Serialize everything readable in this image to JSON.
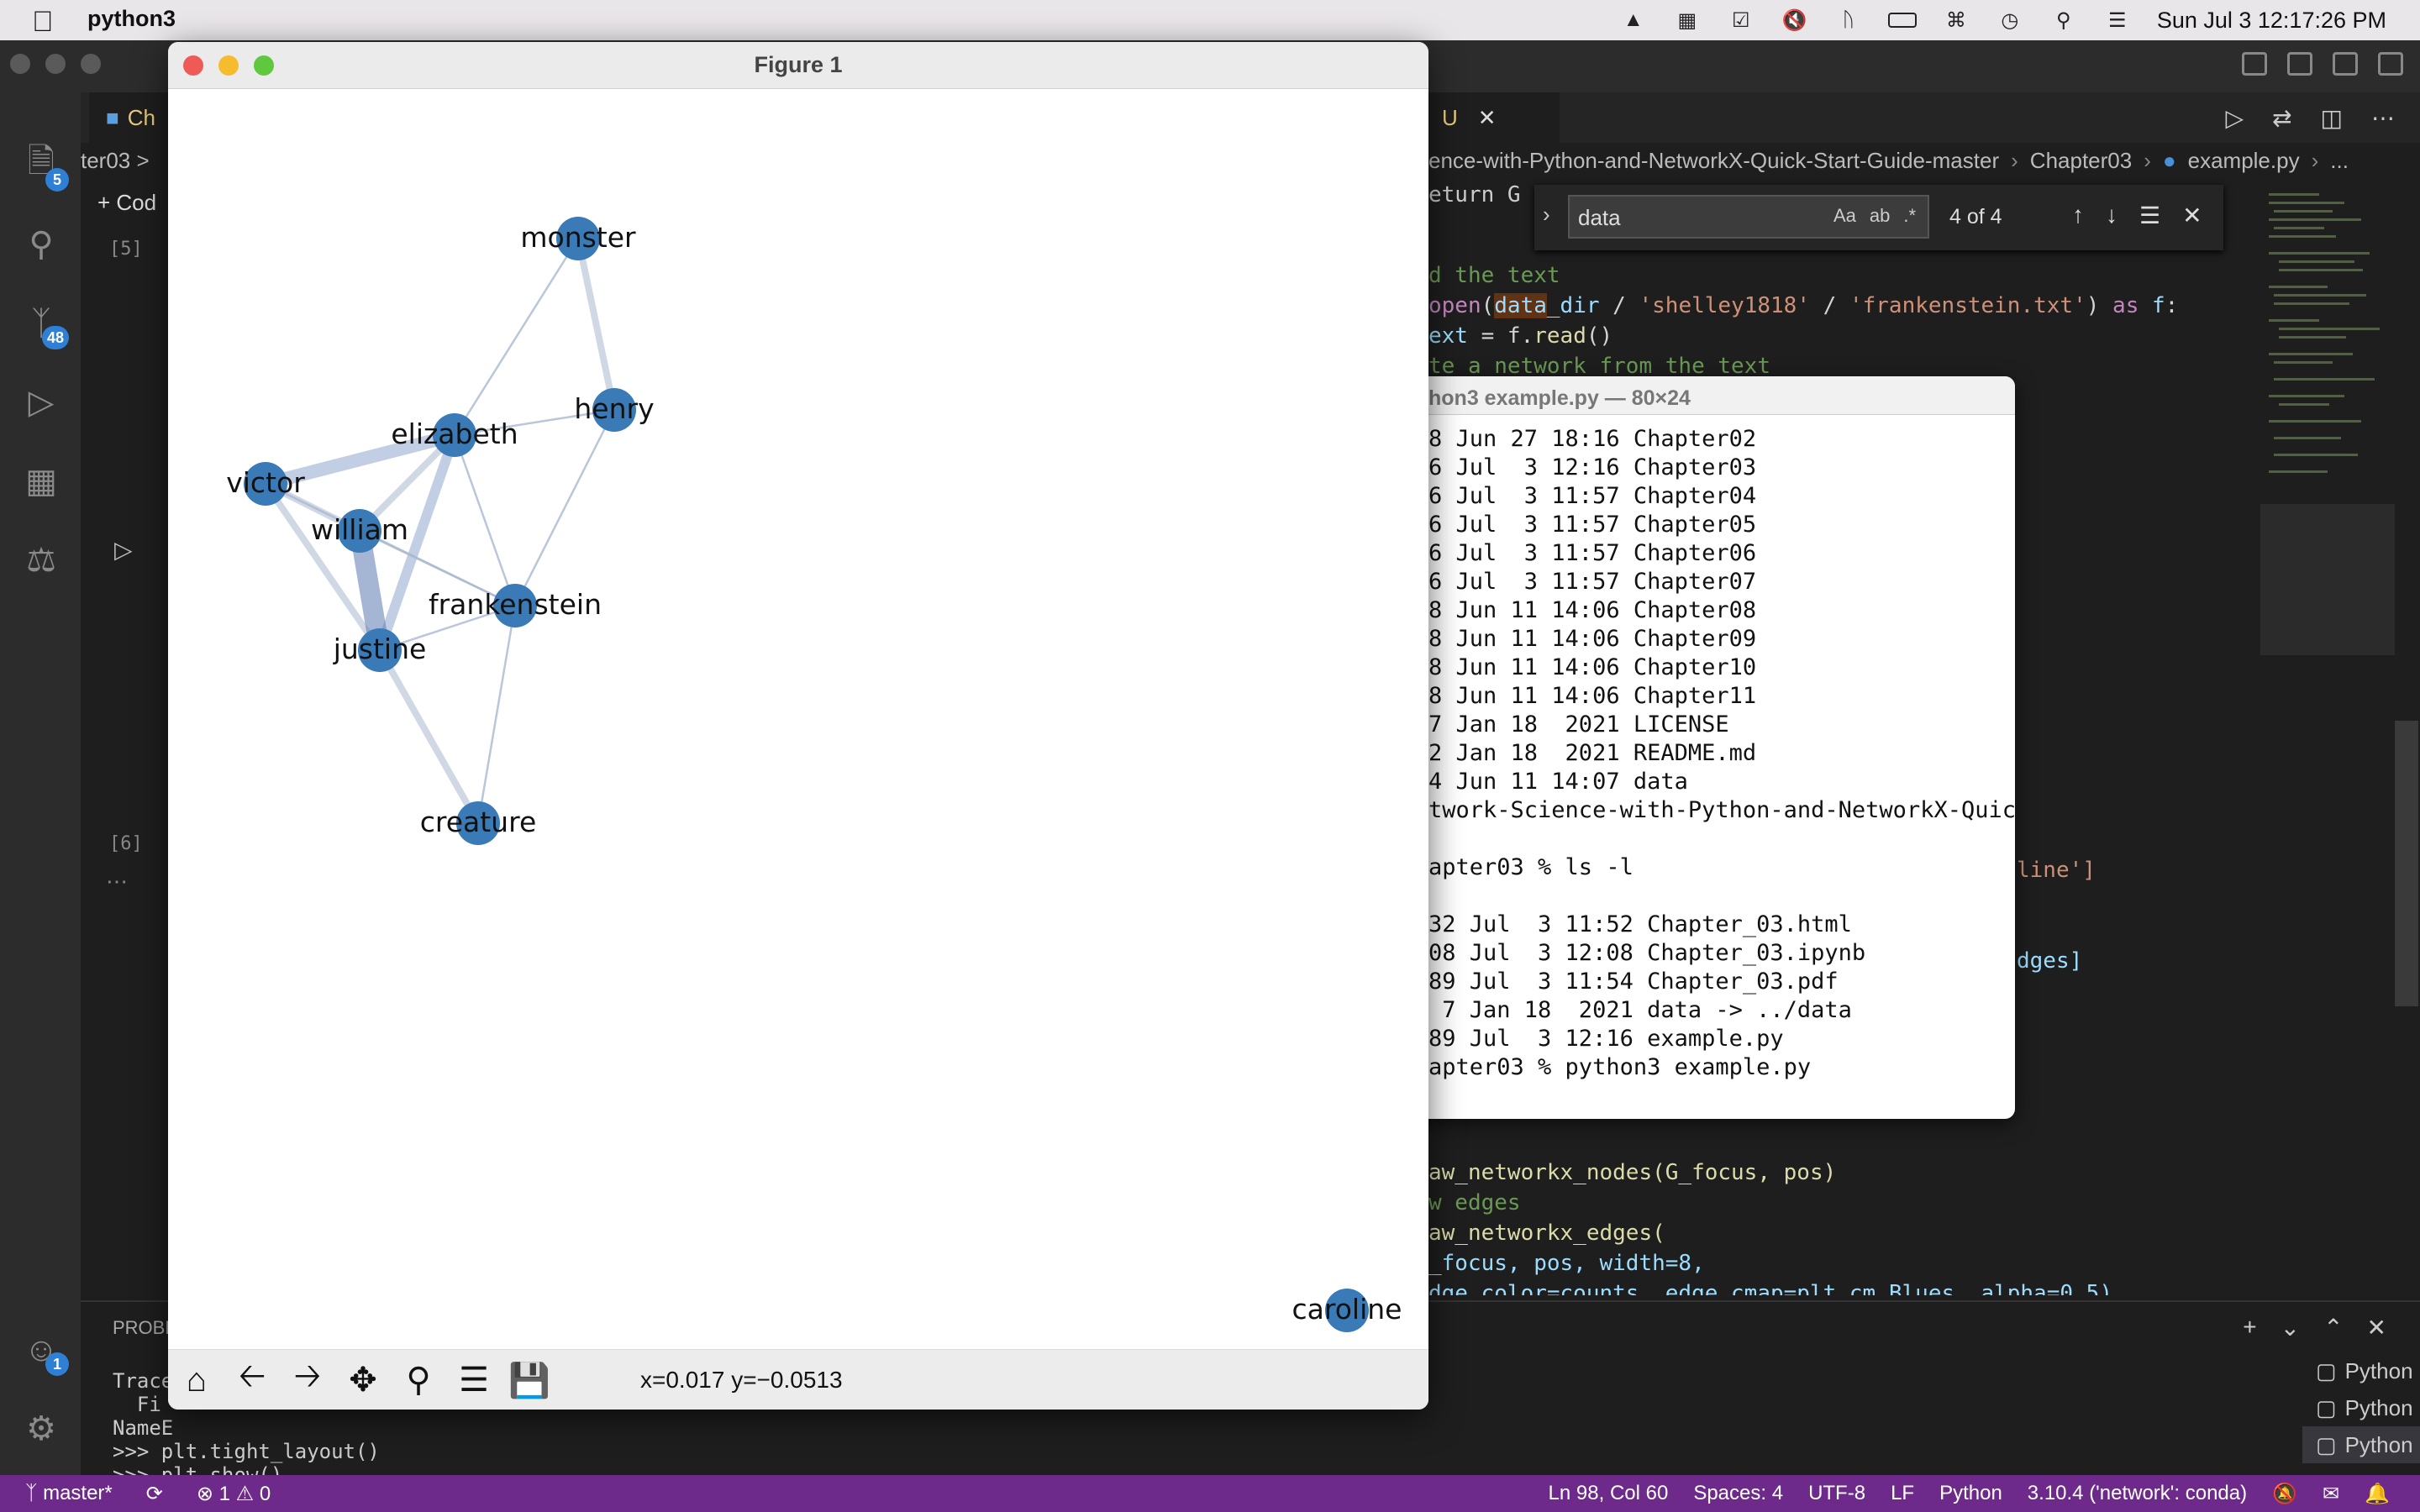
{
  "menubar": {
    "app_name": "python3",
    "datetime": "Sun Jul 3  12:17:26 PM"
  },
  "vscode": {
    "activity_badges": {
      "explorer": "5",
      "source_control": "48",
      "account": "1"
    },
    "tab_left": "Ch",
    "tab_right": "U",
    "breadcrumb_left": "ter03 >",
    "breadcrumb_path": [
      "ence-with-Python-and-NetworkX-Quick-Start-Guide-master",
      "Chapter03",
      "example.py",
      "..."
    ],
    "add_code_label": "+ Cod",
    "cell_labels": [
      "[5]",
      "[6]"
    ],
    "find": {
      "query": "data",
      "options": [
        "Aa",
        "ab",
        ".*"
      ],
      "count": "4 of 4"
    },
    "code_top": [
      {
        "text": "eturn G",
        "cls": "kw"
      },
      {
        "text": "d the text",
        "cls": "cm"
      },
      {
        "text": "open(data_dir / 'shelley1818' / 'frankenstein.txt') as f:",
        "cls": "wh"
      },
      {
        "text": "ext = f.read()",
        "cls": "wh"
      },
      {
        "text": "te a network from the text",
        "cls": "cm"
      }
    ],
    "code_side": [
      "line']",
      "dges]"
    ],
    "code_bottom": [
      {
        "text": "aw_networkx_nodes(G_focus, pos)",
        "cls": "fn"
      },
      {
        "text": "w edges",
        "cls": "cm"
      },
      {
        "text": "aw_networkx_edges(",
        "cls": "fn"
      },
      {
        "text": "_focus, pos, width=8,",
        "cls": "wh"
      },
      {
        "text": "dge_color=counts, edge_cmap=plt.cm.Blues, alpha=0.5)",
        "cls": "wh"
      }
    ],
    "panel": {
      "tab_label": "PROBL",
      "terminal_lines": [
        "Trace",
        "  Fi",
        "NameE",
        ">>> plt.tight_layout()",
        ">>> plt.show()",
        ">>>"
      ],
      "terminal_tabs": [
        "Python  Nat...",
        "Python  Nat...",
        "Python  Nat..."
      ]
    },
    "status": {
      "branch": "master*",
      "problems": "⊗ 1 ⚠ 0",
      "cursor": "Ln 98, Col 60",
      "spaces": "Spaces: 4",
      "encoding": "UTF-8",
      "eol": "LF",
      "language": "Python",
      "interpreter": "3.10.4 ('network': conda)"
    }
  },
  "terminal": {
    "title": "hon3 example.py — 80×24",
    "lines": [
      "8 Jun 27 18:16 Chapter02",
      "6 Jul  3 12:16 Chapter03",
      "6 Jul  3 11:57 Chapter04",
      "6 Jul  3 11:57 Chapter05",
      "6 Jul  3 11:57 Chapter06",
      "6 Jul  3 11:57 Chapter07",
      "8 Jun 11 14:06 Chapter08",
      "8 Jun 11 14:06 Chapter09",
      "8 Jun 11 14:06 Chapter10",
      "8 Jun 11 14:06 Chapter11",
      "7 Jan 18  2021 LICENSE",
      "2 Jan 18  2021 README.md",
      "4 Jun 11 14:07 data",
      "twork-Science-with-Python-and-NetworkX-Quic",
      "",
      "apter03 % ls -l",
      "",
      "32 Jul  3 11:52 Chapter_03.html",
      "08 Jul  3 12:08 Chapter_03.ipynb",
      "89 Jul  3 11:54 Chapter_03.pdf",
      " 7 Jan 18  2021 data -> ../data",
      "89 Jul  3 12:16 example.py",
      "apter03 % python3 example.py"
    ]
  },
  "figure": {
    "title": "Figure 1",
    "coord_readout": "x=0.017 y=−0.0513",
    "node_color": "#3a7ab7",
    "edge_color": "#a9b8d0",
    "nodes": {
      "monster": "monster",
      "henry": "henry",
      "elizabeth": "elizabeth",
      "victor": "victor",
      "william": "william",
      "frankenstein": "frankenstein",
      "justine": "justine",
      "creature": "creature",
      "caroline": "caroline"
    },
    "edges": [
      {
        "source": "monster",
        "target": "elizabeth",
        "weight": 1
      },
      {
        "source": "monster",
        "target": "henry",
        "weight": 2
      },
      {
        "source": "henry",
        "target": "elizabeth",
        "weight": 1
      },
      {
        "source": "henry",
        "target": "frankenstein",
        "weight": 1
      },
      {
        "source": "elizabeth",
        "target": "victor",
        "weight": 4
      },
      {
        "source": "elizabeth",
        "target": "william",
        "weight": 2
      },
      {
        "source": "elizabeth",
        "target": "justine",
        "weight": 3
      },
      {
        "source": "elizabeth",
        "target": "frankenstein",
        "weight": 1
      },
      {
        "source": "victor",
        "target": "william",
        "weight": 2
      },
      {
        "source": "victor",
        "target": "justine",
        "weight": 2
      },
      {
        "source": "victor",
        "target": "frankenstein",
        "weight": 1
      },
      {
        "source": "william",
        "target": "justine",
        "weight": 6
      },
      {
        "source": "william",
        "target": "frankenstein",
        "weight": 1
      },
      {
        "source": "justine",
        "target": "frankenstein",
        "weight": 1
      },
      {
        "source": "justine",
        "target": "creature",
        "weight": 2
      },
      {
        "source": "frankenstein",
        "target": "creature",
        "weight": 1
      }
    ]
  }
}
